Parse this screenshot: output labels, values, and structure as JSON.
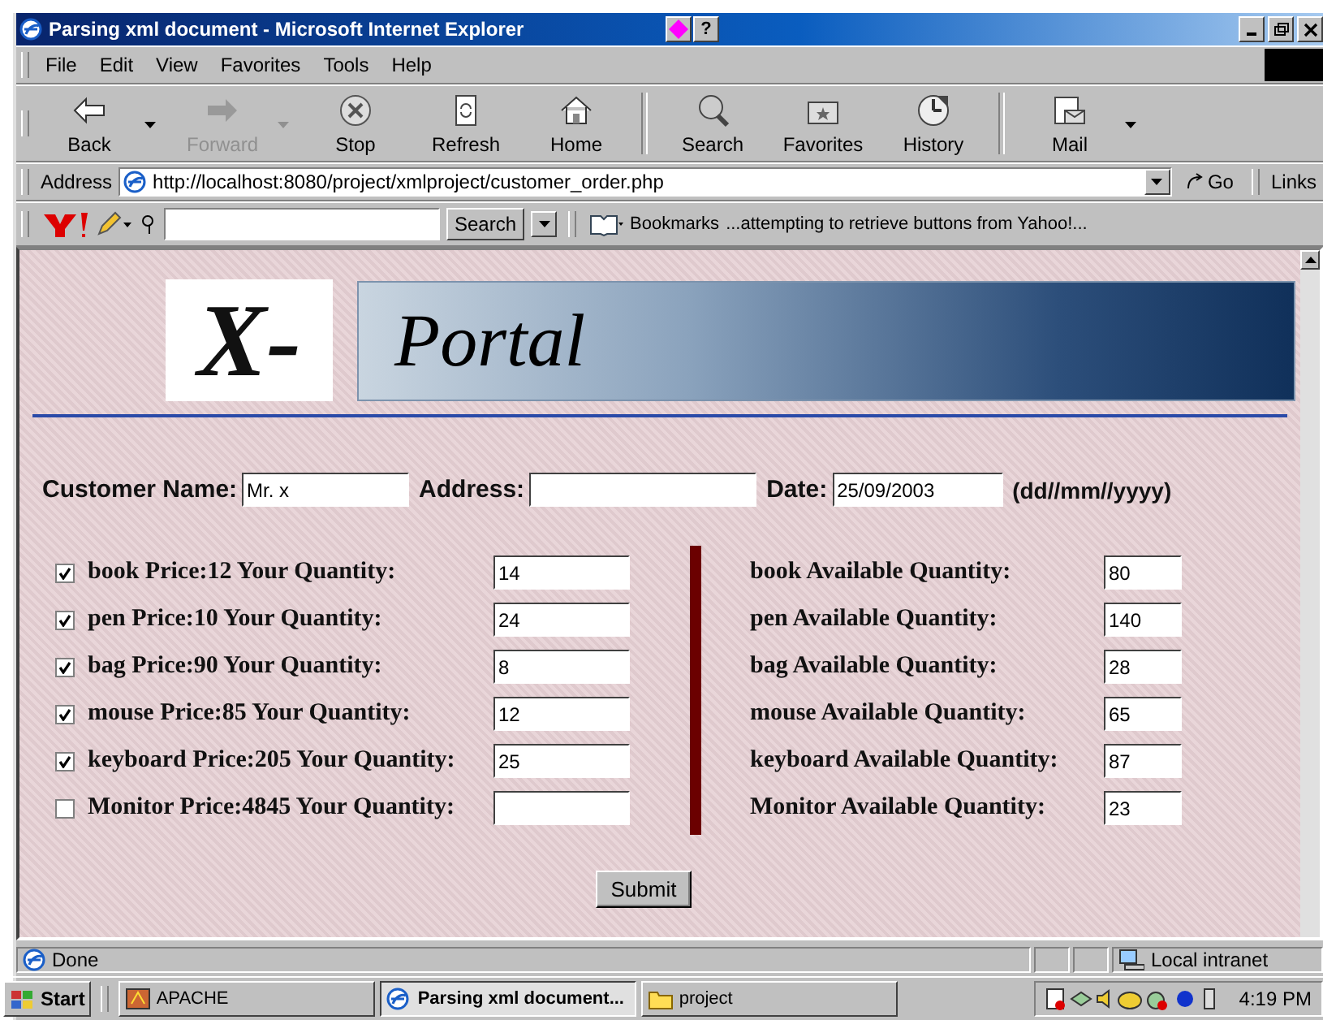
{
  "window": {
    "title": "Parsing xml document - Microsoft Internet Explorer",
    "help_button": "?"
  },
  "menu": [
    "File",
    "Edit",
    "View",
    "Favorites",
    "Tools",
    "Help"
  ],
  "toolbar": [
    {
      "label": "Back",
      "kind": "back",
      "disabled": false,
      "dropdown": true
    },
    {
      "label": "Forward",
      "kind": "forward",
      "disabled": true,
      "dropdown": true
    },
    {
      "label": "Stop",
      "kind": "stop",
      "disabled": false,
      "dropdown": false
    },
    {
      "label": "Refresh",
      "kind": "refresh",
      "disabled": false,
      "dropdown": false
    },
    {
      "label": "Home",
      "kind": "home",
      "disabled": false,
      "dropdown": false
    },
    {
      "label": "Search",
      "kind": "search",
      "disabled": false,
      "dropdown": false
    },
    {
      "label": "Favorites",
      "kind": "favorites",
      "disabled": false,
      "dropdown": false
    },
    {
      "label": "History",
      "kind": "history",
      "disabled": false,
      "dropdown": false
    },
    {
      "label": "Mail",
      "kind": "mail",
      "disabled": false,
      "dropdown": true
    }
  ],
  "address_bar": {
    "label": "Address",
    "url": "http://localhost:8080/project/xmlproject/customer_order.php",
    "go": "Go",
    "links": "Links"
  },
  "yahoo_bar": {
    "search_button": "Search",
    "bookmarks": "Bookmarks",
    "message": "...attempting to retrieve buttons from Yahoo!..."
  },
  "page": {
    "logo_mark": "X-",
    "banner": "Portal",
    "customer": [
      {
        "label": "Customer Name:",
        "value": "Mr. x",
        "kind": "name"
      },
      {
        "label": "Address:",
        "kind": "address"
      },
      {
        "label": "Date:",
        "value": "25/09/2003",
        "kind": "date"
      }
    ],
    "date_hint": "(dd//mm//yyyy)",
    "orders": [
      {
        "label": "book Price:12 Your Quantity:",
        "checked": true,
        "quantity": "14"
      },
      {
        "label": "pen Price:10 Your Quantity:",
        "checked": true,
        "quantity": "24"
      },
      {
        "label": "bag Price:90 Your Quantity:",
        "checked": true,
        "quantity": "8"
      },
      {
        "label": "mouse Price:85 Your Quantity:",
        "checked": true,
        "quantity": "12"
      },
      {
        "label": "keyboard Price:205 Your Quantity:",
        "checked": true,
        "quantity": "25"
      },
      {
        "label": "Monitor Price:4845 Your Quantity:",
        "checked": false
      }
    ],
    "stock": [
      {
        "label": "book Available Quantity:",
        "quantity": "80"
      },
      {
        "label": "pen Available Quantity:",
        "quantity": "140"
      },
      {
        "label": "bag Available Quantity:",
        "quantity": "28"
      },
      {
        "label": "mouse Available Quantity:",
        "quantity": "65"
      },
      {
        "label": "keyboard Available Quantity:",
        "quantity": "87"
      },
      {
        "label": "Monitor Available Quantity:",
        "quantity": "23"
      }
    ],
    "submit": "Submit"
  },
  "status_bar": {
    "text": "Done",
    "zone": "Local intranet"
  },
  "taskbar": {
    "start": "Start",
    "tasks": [
      {
        "label": "APACHE",
        "kind": "app",
        "selected": false
      },
      {
        "label": "Parsing xml document...",
        "kind": "ie",
        "selected": true
      },
      {
        "label": "project",
        "kind": "folder",
        "selected": false
      }
    ],
    "clock": "4:19 PM"
  }
}
